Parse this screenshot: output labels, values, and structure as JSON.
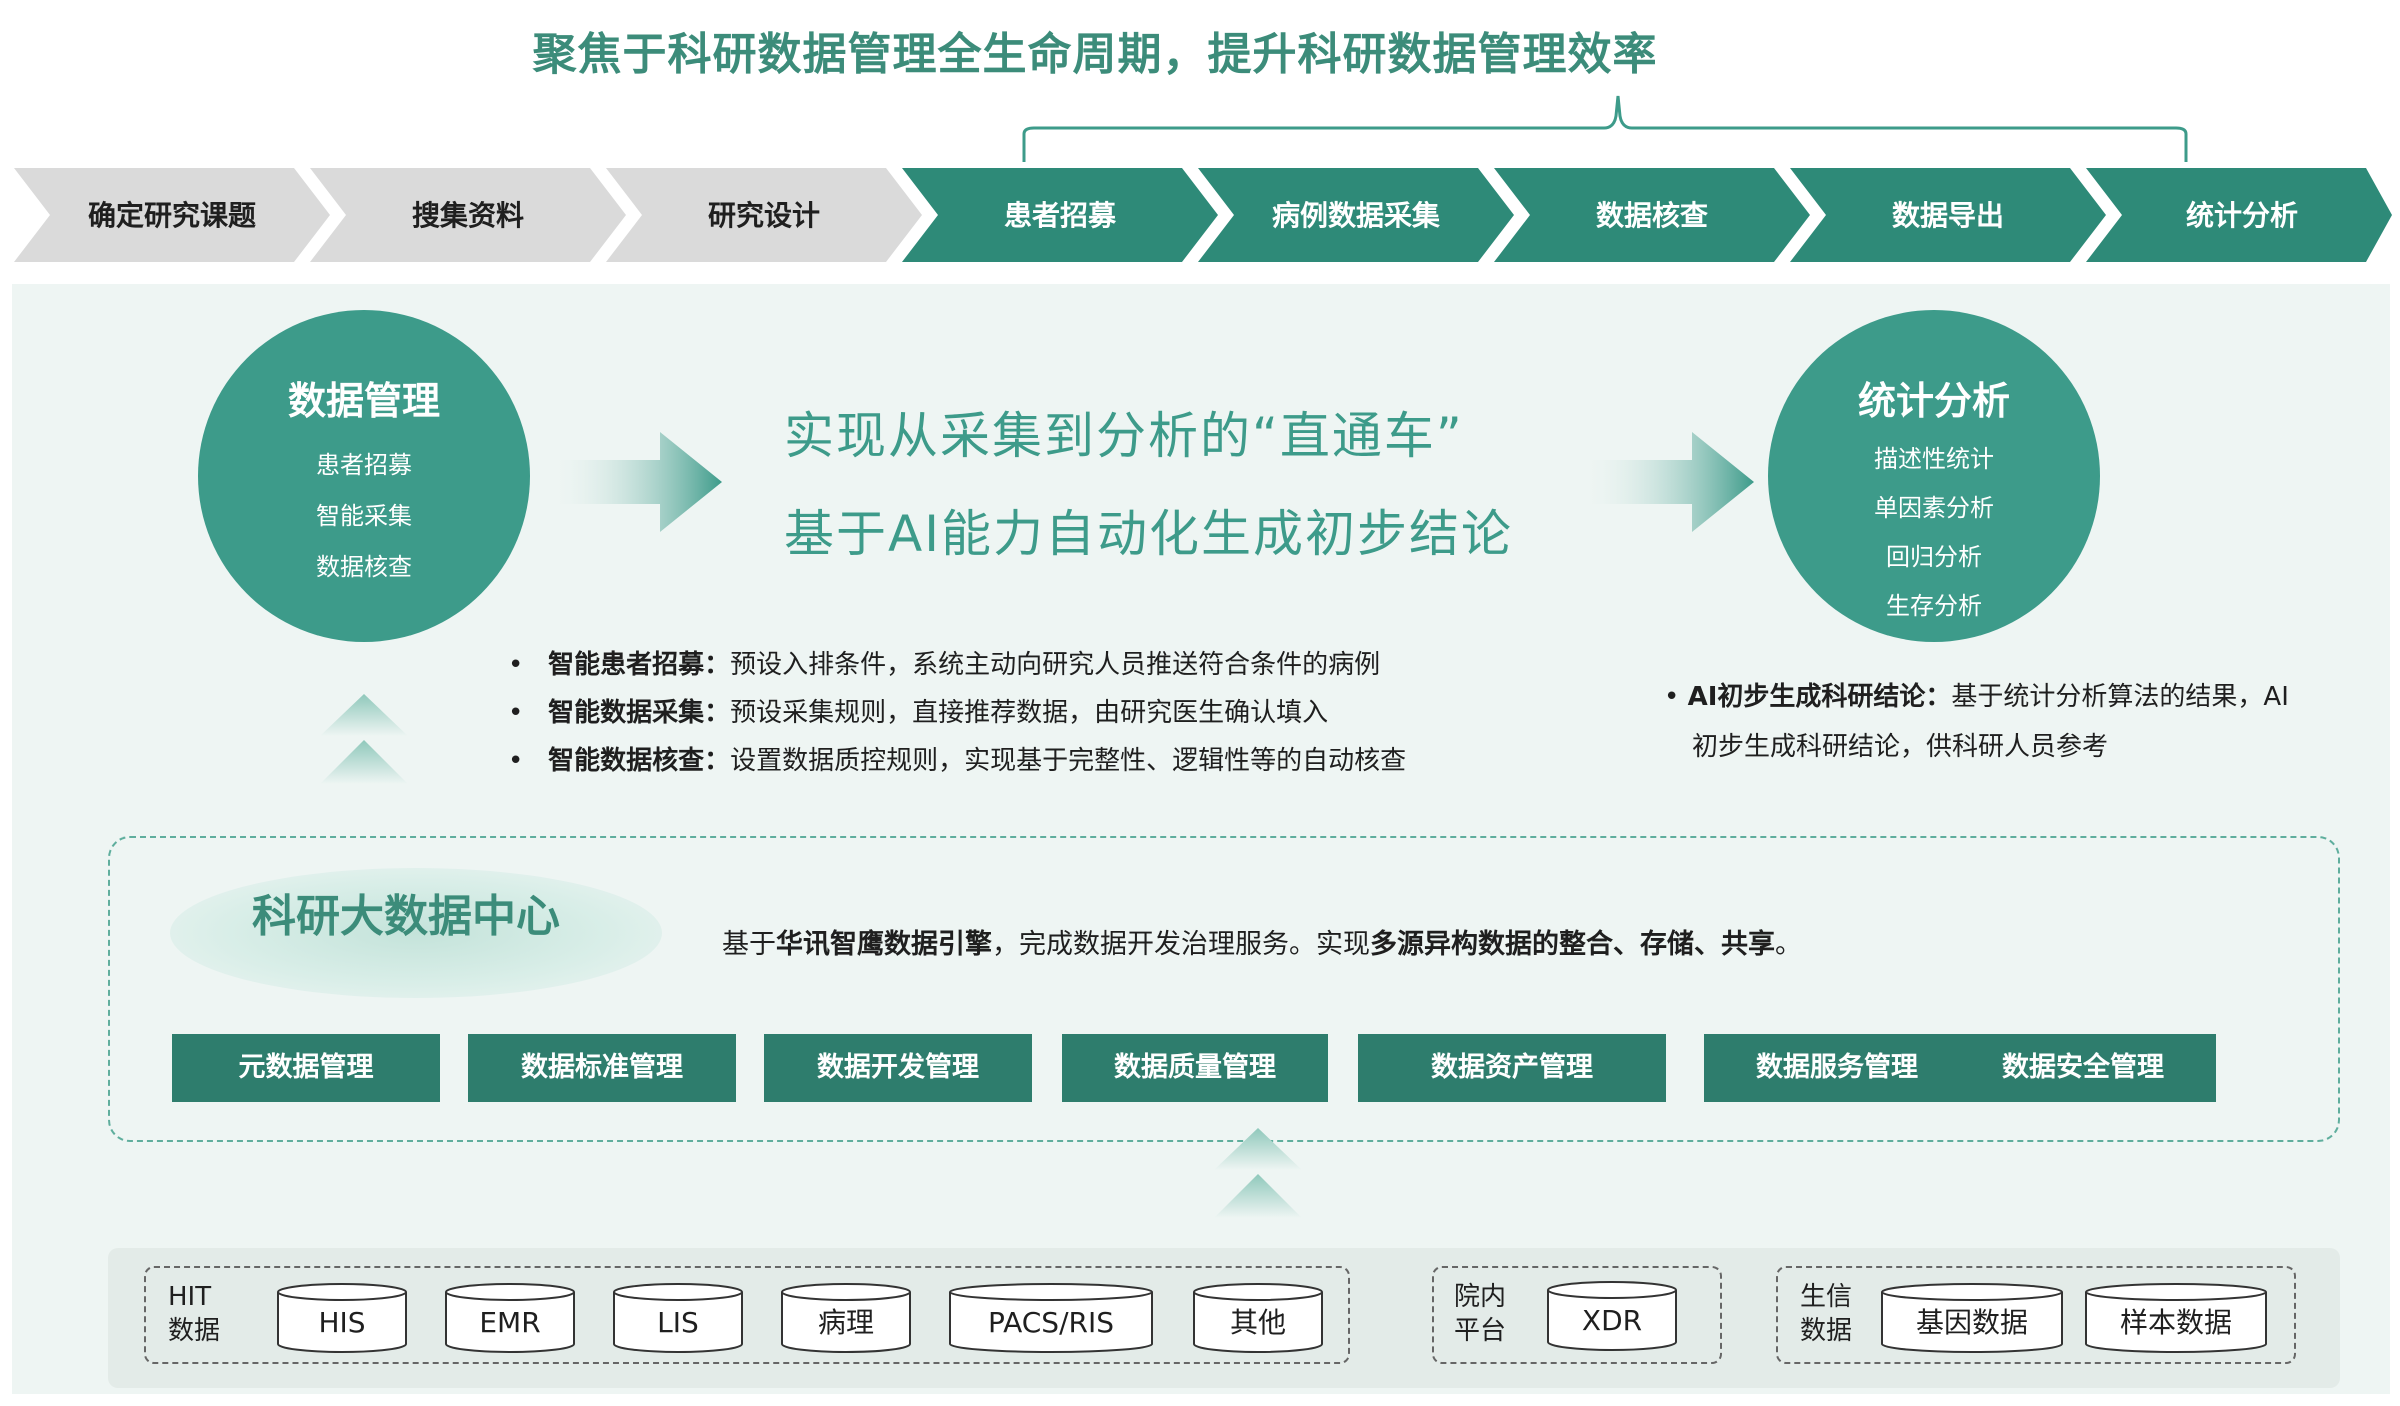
{
  "header": {
    "title": "聚焦于科研数据管理全生命周期，提升科研数据管理效率"
  },
  "steps": [
    {
      "label": "确定研究课题",
      "style": "gray"
    },
    {
      "label": "搜集资料",
      "style": "gray"
    },
    {
      "label": "研究设计",
      "style": "gray"
    },
    {
      "label": "患者招募",
      "style": "green"
    },
    {
      "label": "病例数据采集",
      "style": "green"
    },
    {
      "label": "数据核查",
      "style": "green"
    },
    {
      "label": "数据导出",
      "style": "green"
    },
    {
      "label": "统计分析",
      "style": "green"
    }
  ],
  "left_circle": {
    "title": "数据管理",
    "items": [
      "患者招募",
      "智能采集",
      "数据核查"
    ]
  },
  "right_circle": {
    "title": "统计分析",
    "items": [
      "描述性统计",
      "单因素分析",
      "回归分析",
      "生存分析"
    ]
  },
  "headline": {
    "line1": "实现从采集到分析的“直通车”",
    "line2": "基于AI能力自动化生成初步结论"
  },
  "left_bullets": [
    {
      "bold": "智能患者招募",
      "text": "预设入排条件，系统主动向研究人员推送符合条件的病例"
    },
    {
      "bold": "智能数据采集",
      "text": "预设采集规则，直接推荐数据，由研究医生确认填入"
    },
    {
      "bold": "智能数据核查",
      "text": "设置数据质控规则，实现基于完整性、逻辑性等的自动核查"
    }
  ],
  "right_bullet": {
    "bold": "AI初步生成科研结论",
    "text_line1": "基于统计分析算法的结果，AI",
    "text_line2": "初步生成科研结论，供科研人员参考"
  },
  "bullet_sep": "：",
  "bullet_mark": "•",
  "center": {
    "title": "科研大数据中心",
    "desc_1": "基于",
    "desc_2": "华讯智鹰数据引擎",
    "desc_3": "，完成数据开发治理服务。实现",
    "desc_4": "多源异构数据的整合、存储、共享",
    "desc_5": "。"
  },
  "modules": [
    "元数据管理",
    "数据标准管理",
    "数据开发管理",
    "数据质量管理",
    "数据资产管理",
    "数据服务管理",
    "数据安全管理"
  ],
  "sources": {
    "hit": {
      "label_1": "HIT",
      "label_2": "数据",
      "items": [
        "HIS",
        "EMR",
        "LIS",
        "病理",
        "PACS/RIS",
        "其他"
      ]
    },
    "platform": {
      "label_1": "院内",
      "label_2": "平台",
      "items": [
        "XDR"
      ]
    },
    "bio": {
      "label_1": "生信",
      "label_2": "数据",
      "items": [
        "基因数据",
        "样本数据"
      ]
    }
  },
  "colors": {
    "accent": "#3d9b8a",
    "dark_accent": "#2e7d6d",
    "step_gray": "#d9d9d9",
    "panel_bg": "#eef5f3"
  }
}
